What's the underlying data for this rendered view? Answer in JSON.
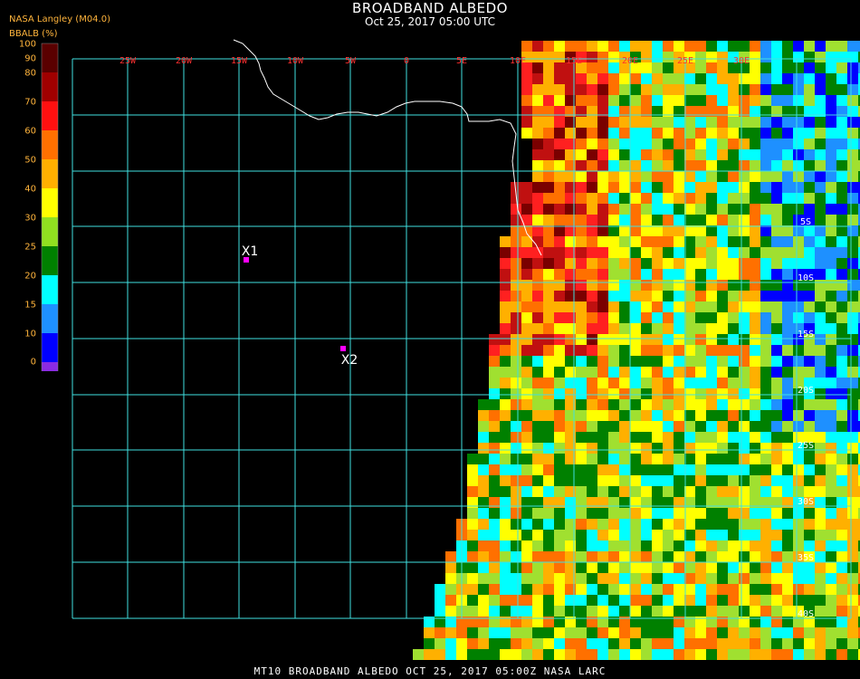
{
  "header": {
    "title": "BROADBAND ALBEDO",
    "subtitle": "Oct 25, 2017 05:00 UTC",
    "provider": "NASA Langley (M04.0)",
    "legend_title": "BBALB (%)"
  },
  "legend": {
    "ticks": [
      "100",
      "90",
      "80",
      "70",
      "60",
      "50",
      "40",
      "30",
      "25",
      "20",
      "15",
      "10",
      "0"
    ],
    "colors": [
      "#5a0000",
      "#a00000",
      "#ff1010",
      "#ff7000",
      "#ffb000",
      "#ffff00",
      "#90e020",
      "#008000",
      "#00ffff",
      "#1e90ff",
      "#0000ff",
      "#8a2be2"
    ]
  },
  "map": {
    "lon_labels": [
      "25W",
      "20W",
      "15W",
      "10W",
      "5W",
      "0",
      "5E",
      "10E",
      "15E",
      "20E",
      "25E",
      "30E"
    ],
    "lat_labels": [
      "5S",
      "10S",
      "15S",
      "20S",
      "25S",
      "30S",
      "35S",
      "40S"
    ],
    "markers": [
      {
        "label": "X1",
        "color": "#ff00ff"
      },
      {
        "label": "X2",
        "color": "#ff00ff"
      }
    ],
    "grid_color": "#40e0e0",
    "label_color": "#ff3030"
  },
  "footer": "MT10  BROADBAND ALBEDO   OCT 25, 2017 05:00Z   NASA LARC"
}
